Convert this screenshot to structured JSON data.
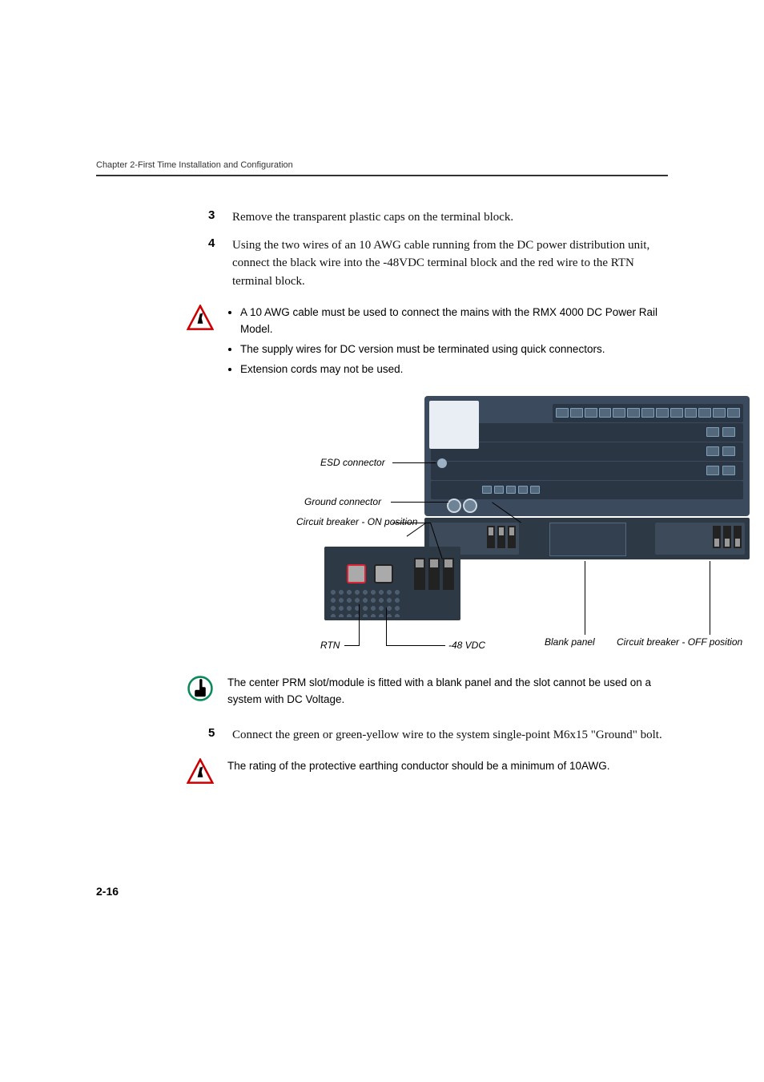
{
  "running_head": "Chapter 2-First Time Installation and Configuration",
  "steps": {
    "s3": {
      "num": "3",
      "text": "Remove the transparent plastic caps on the terminal block."
    },
    "s4": {
      "num": "4",
      "text": "Using the two wires of an 10 AWG cable running from the DC power distribution unit, connect the black wire into the -48VDC terminal block and the red wire to the RTN terminal block."
    },
    "s5": {
      "num": "5",
      "text": "Connect the green or green-yellow wire to the system single-point M6x15 \"Ground\" bolt."
    }
  },
  "warning1": {
    "b1": "A 10 AWG cable must be used to connect the mains with the RMX 4000 DC Power Rail Model.",
    "b2": "The supply wires for DC version must be terminated using quick connectors.",
    "b3": "Extension cords may not be used."
  },
  "callouts": {
    "esd": "ESD connector",
    "gnd": "Ground connector",
    "cb_on": "Circuit breaker - ON position",
    "rtn": "RTN",
    "v48": "-48 VDC",
    "blank": "Blank panel",
    "cb_off": "Circuit breaker - OFF position"
  },
  "note2": "The center PRM slot/module is fitted with a blank panel and the slot cannot be used on a system with DC Voltage.",
  "warning3": "The rating of the protective earthing conductor should be a minimum of 10AWG.",
  "page_num": "2-16"
}
